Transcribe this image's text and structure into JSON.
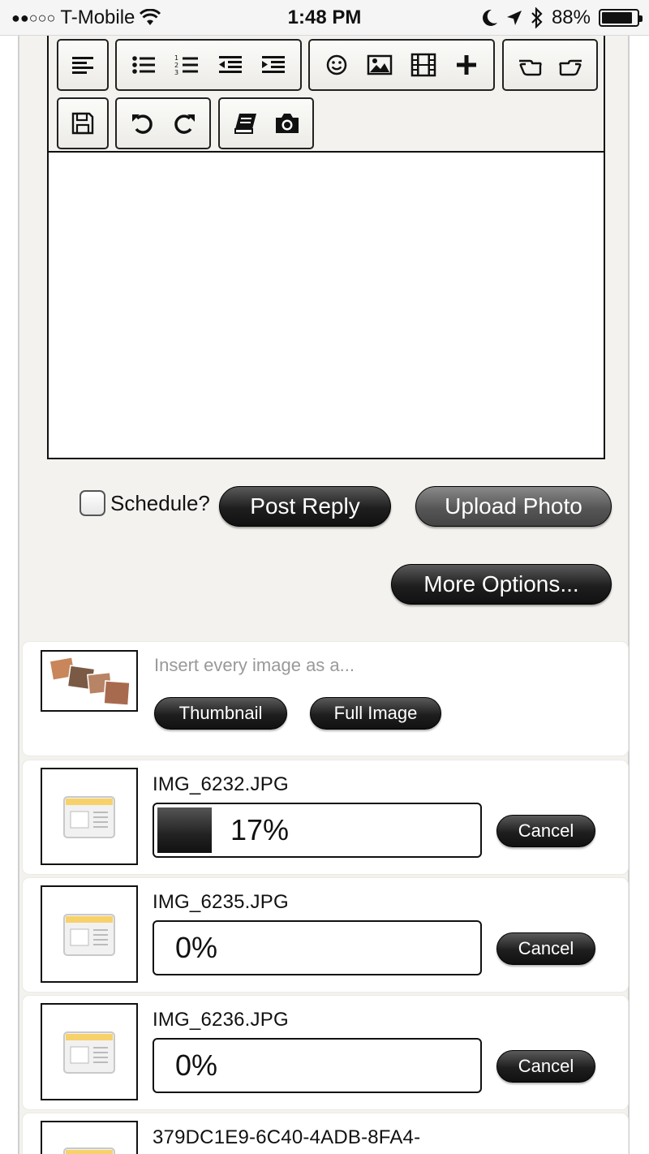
{
  "status_bar": {
    "signal": "●●○○○",
    "carrier": "T-Mobile",
    "time": "1:48 PM",
    "battery": "88%",
    "battery_level": 0.88
  },
  "toolbar": {
    "groups": [
      [
        "align-left-icon"
      ],
      [
        "bulleted-list-icon",
        "numbered-list-icon",
        "outdent-icon",
        "indent-icon"
      ],
      [
        "smiley-icon",
        "image-icon",
        "video-icon",
        "plus-icon"
      ],
      [
        "hand-left-icon",
        "hand-right-icon"
      ],
      [
        "save-icon"
      ],
      [
        "undo-icon",
        "redo-icon"
      ],
      [
        "book-icon",
        "camera-icon"
      ]
    ]
  },
  "editor": {
    "value": ""
  },
  "actions": {
    "schedule_label": "Schedule?",
    "schedule_checked": false,
    "post_reply": "Post Reply",
    "upload_photo": "Upload Photo",
    "more_options": "More Options..."
  },
  "insert_all": {
    "hint": "Insert every image as a...",
    "thumbnail": "Thumbnail",
    "full_image": "Full Image"
  },
  "uploads": [
    {
      "filename": "IMG_6232.JPG",
      "progress_label": "17%",
      "progress": 0.17,
      "cancel": "Cancel"
    },
    {
      "filename": "IMG_6235.JPG",
      "progress_label": "0%",
      "progress": 0,
      "cancel": "Cancel"
    },
    {
      "filename": "IMG_6236.JPG",
      "progress_label": "0%",
      "progress": 0,
      "cancel": "Cancel"
    },
    {
      "filename": "379DC1E9-6C40-4ADB-8FA4-"
    }
  ],
  "colors": {
    "button_dark": "#1e1e1e",
    "page_bg": "#f3f2ee",
    "hint_text": "#999999"
  }
}
